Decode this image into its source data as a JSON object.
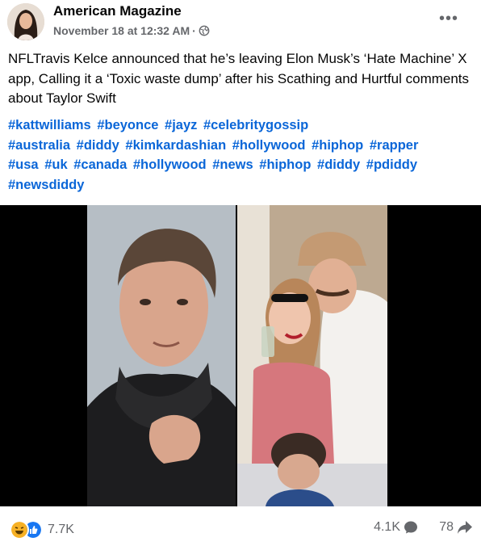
{
  "post": {
    "page_name": "American Magazine",
    "timestamp": "November 18 at 12:32 AM",
    "separator": "·",
    "text": "NFLTravis Kelce announced that he’s leaving Elon Musk’s ‘Hate Machine’ X app, Calling it a ‘Toxic waste dump’ after his Scathing and Hurtful comments about Taylor Swift",
    "hashtags": [
      "#kattwilliams",
      "#beyonce",
      "#jayz",
      "#celebritygossip",
      "#australia",
      "#diddy",
      "#kimkardashian",
      "#hollywood",
      "#hiphop",
      "#rapper",
      "#usa",
      "#uk",
      "#canada",
      "#hollywood",
      "#news",
      "#hiphop",
      "#diddy",
      "#pdiddy",
      "#newsdiddy"
    ],
    "more_icon": "•••"
  },
  "stats": {
    "reactions": "7.7K",
    "comments": "4.1K",
    "shares": "78"
  },
  "colors": {
    "link": "#0a66d8",
    "meta": "#65676b"
  }
}
